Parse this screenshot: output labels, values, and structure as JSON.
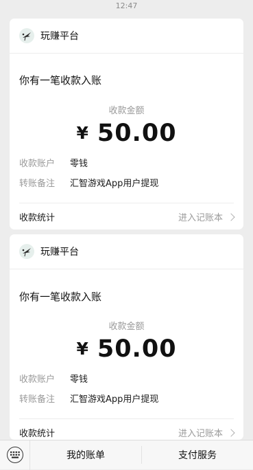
{
  "status_bar": {
    "time": "12:47"
  },
  "cards": [
    {
      "app_name": "玩赚平台",
      "title": "你有一笔收款入账",
      "amount_label": "收款金额",
      "currency": "¥",
      "amount": "50.00",
      "account_key": "收款账户",
      "account_value": "零钱",
      "remark_key": "转账备注",
      "remark_value": "汇智游戏App用户提现",
      "stats_label": "收款统计",
      "ledger_link": "进入记账本"
    },
    {
      "app_name": "玩赚平台",
      "title": "你有一笔收款入账",
      "amount_label": "收款金额",
      "currency": "¥",
      "amount": "50.00",
      "account_key": "收款账户",
      "account_value": "零钱",
      "remark_key": "转账备注",
      "remark_value": "汇智游戏App用户提现",
      "stats_label": "收款统计",
      "ledger_link": "进入记账本"
    }
  ],
  "bottom_menu": {
    "items": [
      "我的账单",
      "支付服务"
    ]
  },
  "icons": {
    "logo": "crane-logo-icon",
    "keyboard": "keyboard-icon",
    "chevron": "chevron-right-icon"
  }
}
